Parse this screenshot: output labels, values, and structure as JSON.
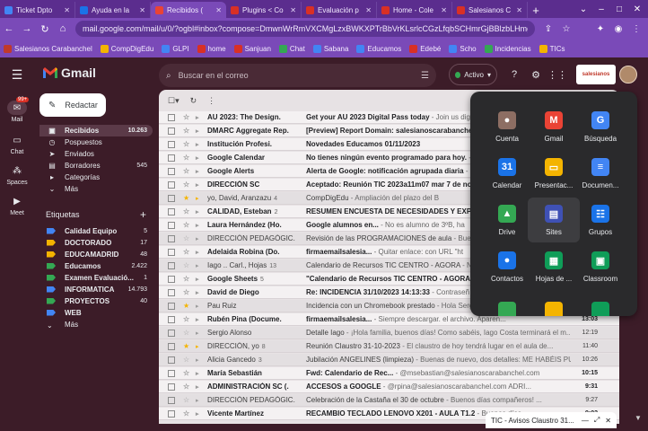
{
  "browser": {
    "tabs": [
      {
        "title": "Ticket Dpto",
        "color": "#4285f4"
      },
      {
        "title": "Ayuda en la",
        "color": "#1a73e8"
      },
      {
        "title": "Recibidos (",
        "color": "#ea4335"
      },
      {
        "title": "Plugins < Co",
        "color": "#d93025"
      },
      {
        "title": "Evaluación p",
        "color": "#d93025"
      },
      {
        "title": "Home - Cole",
        "color": "#d93025"
      },
      {
        "title": "Salesianos C",
        "color": "#d93025"
      }
    ],
    "new_tab": "+",
    "url": "mail.google.com/mail/u/0/?ogbl#inbox?compose=DmwnWrRmVXCMgLzxBWKXPTrBbVrKLsrlcCGzLfqbSCHmrGjBBlzbLHmgFD...",
    "bookmarks": [
      {
        "label": "Salesianos Carabanchel",
        "color": "#c0392b"
      },
      {
        "label": "CompDigEdu",
        "color": "#f4b400"
      },
      {
        "label": "GLPI",
        "color": "#4285f4"
      },
      {
        "label": "home",
        "color": "#d93025"
      },
      {
        "label": "Sanjuan",
        "color": "#d93025"
      },
      {
        "label": "Chat",
        "color": "#34a853"
      },
      {
        "label": "Sabana",
        "color": "#4285f4"
      },
      {
        "label": "Educamos",
        "color": "#4285f4"
      },
      {
        "label": "Edebé",
        "color": "#d93025"
      },
      {
        "label": "Scho",
        "color": "#4285f4"
      },
      {
        "label": "Incidencias",
        "color": "#34a853"
      },
      {
        "label": "TICs",
        "color": "#f4b400"
      }
    ]
  },
  "gmail": {
    "logo": "Gmail",
    "search_placeholder": "Buscar en el correo",
    "status": "Activo",
    "brand": "salesianos",
    "compose": "Redactar",
    "rail": [
      {
        "label": "Mail",
        "badge": "99+"
      },
      {
        "label": "Chat"
      },
      {
        "label": "Spaces"
      },
      {
        "label": "Meet"
      }
    ],
    "folders": [
      {
        "label": "Recibidos",
        "count": "10.263",
        "icon": "▣"
      },
      {
        "label": "Pospuestos",
        "count": "",
        "icon": "◷"
      },
      {
        "label": "Enviados",
        "count": "",
        "icon": "➤"
      },
      {
        "label": "Borradores",
        "count": "545",
        "icon": "▤"
      },
      {
        "label": "Categorías",
        "count": "",
        "icon": "▸"
      },
      {
        "label": "Más",
        "count": "",
        "icon": "⌄"
      }
    ],
    "labels_title": "Etiquetas",
    "labels": [
      {
        "label": "Calidad Equipo",
        "count": "5",
        "color": "#4285f4"
      },
      {
        "label": "DOCTORADO",
        "count": "17",
        "color": "#f4b400"
      },
      {
        "label": "EDUCAMADRID",
        "count": "48",
        "color": "#f4b400"
      },
      {
        "label": "Educamos",
        "count": "2.422",
        "color": "#34a853"
      },
      {
        "label": "Examen Evaluació...",
        "count": "1",
        "color": "#34a853"
      },
      {
        "label": "INFORMATICA",
        "count": "14.793",
        "color": "#4285f4"
      },
      {
        "label": "PROYECTOS",
        "count": "40",
        "color": "#34a853"
      },
      {
        "label": "WEB",
        "count": "",
        "color": "#4285f4"
      },
      {
        "label": "Más",
        "count": "",
        "color": ""
      }
    ],
    "emails": [
      {
        "sender": "AU 2023: The Design.",
        "count": "",
        "subject": "Get your AU 2023 Digital Pass today",
        "snippet": " - Join us digitally",
        "time": "",
        "unread": true,
        "star": false,
        "important": false
      },
      {
        "sender": "DMARC Aggregate Rep.",
        "count": "",
        "subject": "[Preview] Report Domain: salesianoscarabanchel",
        "snippet": "",
        "time": "",
        "unread": true,
        "star": false,
        "important": false
      },
      {
        "sender": "Institución Profesi.",
        "count": "",
        "subject": "Novedades Educamos 01/11/2023",
        "snippet": "",
        "time": "",
        "unread": true,
        "star": false,
        "important": false
      },
      {
        "sender": "Google Calendar",
        "count": "",
        "subject": "No tienes ningún evento programado para hoy.",
        "snippet": " - Te",
        "time": "",
        "unread": true,
        "star": false,
        "important": false
      },
      {
        "sender": "Google Alerts",
        "count": "",
        "subject": "Alerta de Google: notificación agrupada diaria",
        "snippet": " - Este",
        "time": "",
        "unread": true,
        "star": false,
        "important": false
      },
      {
        "sender": "DIRECCIÓN SC",
        "count": "",
        "subject": "Aceptado: Reunión TIC 2023a11m07 mar 7 de nov",
        "snippet": "",
        "time": "",
        "unread": true,
        "star": false,
        "important": false
      },
      {
        "sender": "yo, David, Aranzazu",
        "count": "4",
        "subject": "CompDigEdu",
        "snippet": " - Ampliación del plazo del B",
        "time": "",
        "unread": false,
        "star": true,
        "important": true
      },
      {
        "sender": "CALIDAD, Esteban",
        "count": "2",
        "subject": "RESUMEN ENCUESTA DE NECESIDADES Y EXPECT",
        "snippet": "",
        "time": "",
        "unread": true,
        "star": false,
        "important": false
      },
      {
        "sender": "Laura Hernández (Ho.",
        "count": "",
        "subject": "Google alumnos en...",
        "snippet": " - No es alumno de 3ºB, ha",
        "time": "",
        "unread": true,
        "star": false,
        "important": false
      },
      {
        "sender": "DIRECCIÓN PEDAGÓGIC.",
        "count": "",
        "subject": "Revisión de las PROGRAMACIONES de aula",
        "snippet": " - Buenos",
        "time": "",
        "unread": false,
        "star": false,
        "important": false
      },
      {
        "sender": "Adelaida Robina (Do.",
        "count": "",
        "subject": "firmaemailsalesia...",
        "snippet": " - Quitar enlace: con URL \"ht",
        "time": "",
        "unread": true,
        "star": false,
        "important": false
      },
      {
        "sender": "Iago .. Carl., Hojas",
        "count": "13",
        "subject": "Calendario de Recursos TIC CENTRO - AGORA",
        "snippet": " - Nue",
        "time": "",
        "unread": false,
        "star": false,
        "important": false
      },
      {
        "sender": "Google Sheets",
        "count": "5",
        "subject": "\"Calendario de Recursos TIC CENTRO - AGORA\"",
        "snippet": "",
        "time": "",
        "unread": true,
        "star": false,
        "important": false
      },
      {
        "sender": "David de Diego",
        "count": "",
        "subject": "Re: INCIDENCIA 31/10/2023 14:13:33",
        "snippet": " - Contraseñ",
        "time": "",
        "unread": true,
        "star": false,
        "important": false
      },
      {
        "sender": "Pau Ruiz",
        "count": "",
        "subject": "Incidencia con un Chromebook prestado",
        "snippet": " - Hola Serg",
        "time": "",
        "unread": false,
        "star": true,
        "important": false
      },
      {
        "sender": "Rubén Pina (Docume.",
        "count": "",
        "subject": "firmaemailsalesia...",
        "snippet": " - Siempre descargar. el archivo. Aparen...",
        "time": "13:03",
        "unread": true,
        "star": false,
        "important": false
      },
      {
        "sender": "Sergio Alonso",
        "count": "",
        "subject": "Detalle Iago",
        "snippet": " - ¡Hola familia, buenos días! Como sabéis, Iago Costa terminará el m...",
        "time": "12:19",
        "unread": false,
        "star": false,
        "important": false
      },
      {
        "sender": "DIRECCIÓN, yo",
        "count": "8",
        "subject": "Reunión Claustro 31-10-2023",
        "snippet": " - El claustro de hoy tendrá lugar en el aula de...",
        "time": "11:40",
        "unread": false,
        "star": true,
        "important": true
      },
      {
        "sender": "Alicia Gancedo",
        "count": "3",
        "subject": "Jubilación ANGELINES (limpieza)",
        "snippet": " - Buenas de nuevo, dos detalles: ME HABÉIS PU...",
        "time": "10:26",
        "unread": false,
        "star": false,
        "important": false
      },
      {
        "sender": "María Sebastián",
        "count": "",
        "subject": "Fwd: Calendario de Rec...",
        "snippet": " - @msebastian@salesianoscarabanchel.com",
        "time": "10:15",
        "unread": true,
        "star": false,
        "important": false
      },
      {
        "sender": "ADMINISTRACIÓN SC (.",
        "count": "",
        "subject": "ACCESOS a GOOGLE",
        "snippet": " - @rpina@salesianoscarabanchel.com ADRI...",
        "time": "9:31",
        "unread": true,
        "star": false,
        "important": false
      },
      {
        "sender": "DIRECCIÓN PEDAGÓGIC.",
        "count": "",
        "subject": "Celebración de la Castaña el 30 de octubre",
        "snippet": " - Buenos días compañeros! ...",
        "time": "9:27",
        "unread": false,
        "star": false,
        "important": false
      },
      {
        "sender": "Vicente Martínez",
        "count": "",
        "subject": "RECAMBIO TECLADO LENOVO X201 - AULA T1.2",
        "snippet": " - Buenos días ...",
        "time": "9:02",
        "unread": true,
        "star": false,
        "important": false
      }
    ],
    "apps": [
      {
        "label": "Cuenta",
        "icon": "●",
        "color": "#8d6e63"
      },
      {
        "label": "Gmail",
        "icon": "M",
        "color": "#ea4335"
      },
      {
        "label": "Búsqueda",
        "icon": "G",
        "color": "#4285f4"
      },
      {
        "label": "Calendar",
        "icon": "31",
        "color": "#1a73e8"
      },
      {
        "label": "Presentac...",
        "icon": "▭",
        "color": "#f4b400"
      },
      {
        "label": "Documen...",
        "icon": "≡",
        "color": "#4285f4"
      },
      {
        "label": "Drive",
        "icon": "▲",
        "color": "#34a853"
      },
      {
        "label": "Sites",
        "icon": "▤",
        "color": "#3f51b5"
      },
      {
        "label": "Grupos",
        "icon": "☷",
        "color": "#1a73e8"
      },
      {
        "label": "Contactos",
        "icon": "●",
        "color": "#1a73e8"
      },
      {
        "label": "Hojas de ...",
        "icon": "▦",
        "color": "#0f9d58"
      },
      {
        "label": "Classroom",
        "icon": "▣",
        "color": "#0f9d58"
      }
    ],
    "chat_popup": "TIC - Avisos Claustro 31..."
  }
}
